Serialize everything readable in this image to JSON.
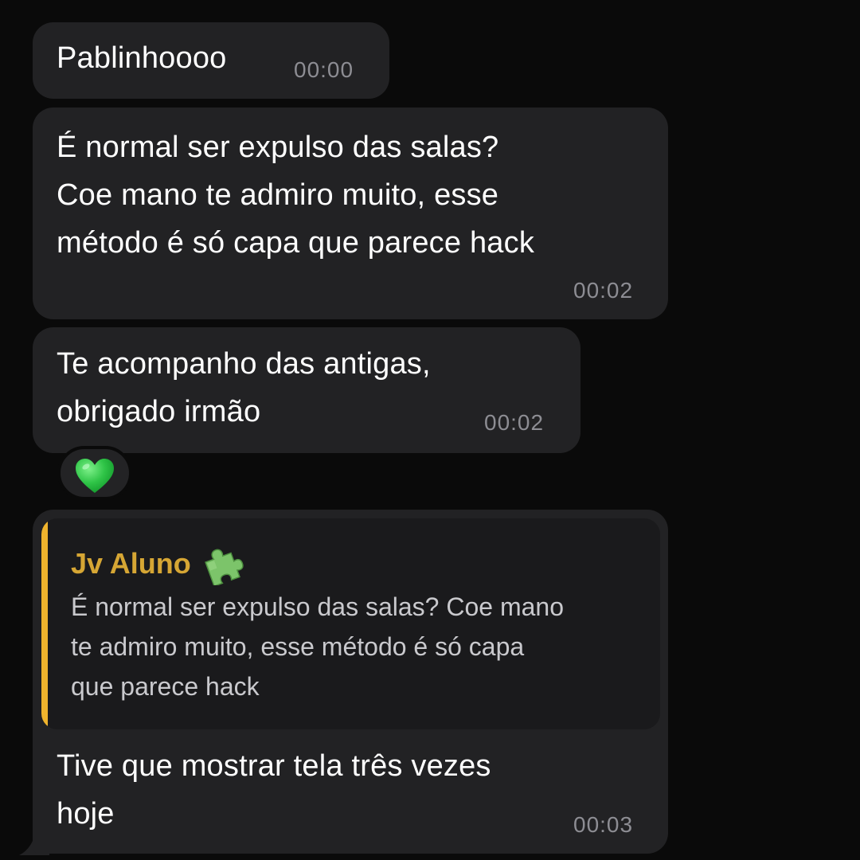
{
  "messages": [
    {
      "text": "Pablinhoooo",
      "time": "00:00"
    },
    {
      "text": "É normal ser expulso das salas?\nCoe mano te admiro muito, esse\nmétodo é só capa que parece hack",
      "time": "00:02"
    },
    {
      "text": "Te acompanho das antigas,\nobrigado irmão",
      "time": "00:02",
      "reaction": "green-heart-icon"
    },
    {
      "reply": {
        "sender": "Jv Aluno",
        "sender_icon": "puzzle-piece-icon",
        "text": "É normal ser expulso das salas? Coe mano\nte admiro muito, esse método é só capa\nque parece hack"
      },
      "text": "Tive que mostrar tela três vezes\nhoje",
      "time": "00:03"
    }
  ],
  "colors": {
    "background": "#0a0a0a",
    "bubble": "#222224",
    "reply_accent": "#f0b42d",
    "reply_sender": "#d6a634",
    "reaction_heart": "#3ccf4e"
  }
}
